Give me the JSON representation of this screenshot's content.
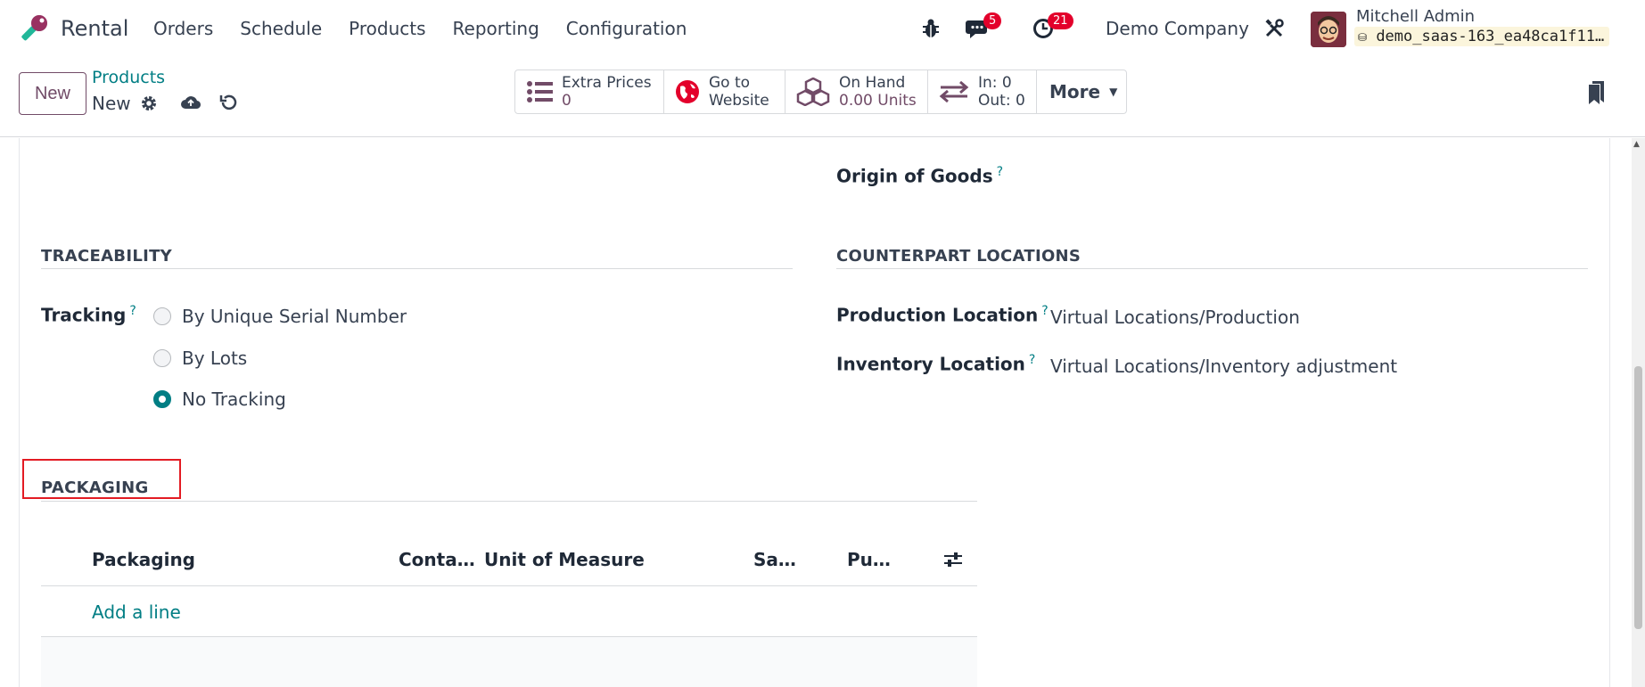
{
  "navbar": {
    "app_name": "Rental",
    "menu": [
      "Orders",
      "Schedule",
      "Products",
      "Reporting",
      "Configuration"
    ],
    "messages_count": "5",
    "activities_count": "21",
    "company": "Demo Company",
    "user_name": "Mitchell Admin",
    "database": "demo_saas-163_ea48ca1f11…"
  },
  "control": {
    "new_label": "New",
    "breadcrumb_parent": "Products",
    "breadcrumb_current": "New",
    "smart_buttons": {
      "extra_prices_label": "Extra Prices",
      "extra_prices_value": "0",
      "website_line1": "Go to",
      "website_line2": "Website",
      "onhand_label": "On Hand",
      "onhand_value": "0.00 Units",
      "in_label": "In: 0",
      "out_label": "Out: 0",
      "more_label": "More"
    }
  },
  "form": {
    "origin_label": "Origin of Goods",
    "traceability_title": "TRACEABILITY",
    "tracking_label": "Tracking",
    "tracking_options": [
      "By Unique Serial Number",
      "By Lots",
      "No Tracking"
    ],
    "tracking_selected": "No Tracking",
    "counterpart_title": "COUNTERPART LOCATIONS",
    "production_location_label": "Production Location",
    "production_location_value": "Virtual Locations/Production",
    "inventory_location_label": "Inventory Location",
    "inventory_location_value": "Virtual Locations/Inventory adjustment",
    "packaging_title": "PACKAGING",
    "packaging_columns": [
      "Packaging",
      "Conta…",
      "Unit of Measure",
      "Sa…",
      "Pu…"
    ],
    "add_line": "Add a line"
  },
  "colors": {
    "brand": "#714b67",
    "link": "#017e84",
    "badge": "#e3002b",
    "highlight": "#e31b23"
  }
}
